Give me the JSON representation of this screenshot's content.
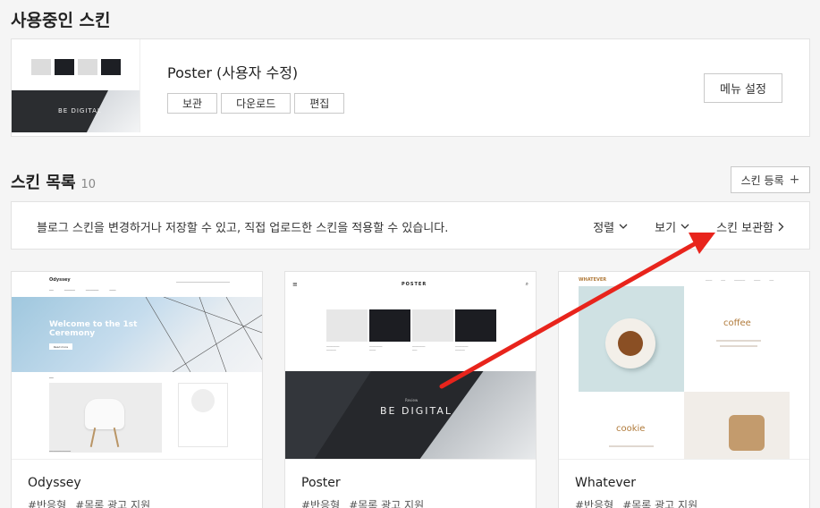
{
  "current": {
    "heading": "사용중인 스킨",
    "title": "Poster (사용자 수정)",
    "buttons": [
      "보관",
      "다운로드",
      "편집"
    ],
    "menu_button": "메뉴 설정",
    "thumb_text": "BE DIGITAL"
  },
  "list": {
    "heading": "스킨 목록",
    "count": "10",
    "register_button": "스킨 등록",
    "info": "블로그 스킨을 변경하거나 저장할 수 있고, 직접 업로드한 스킨을 적용할 수 있습니다.",
    "filters": {
      "sort": "정렬",
      "view": "보기",
      "storage": "스킨 보관함"
    }
  },
  "skins": [
    {
      "name": "Odyssey",
      "tags": [
        "#반응형",
        "#목록 광고 지원"
      ],
      "preview": {
        "logo": "Odyssey",
        "hero_title_1": "Welcome to the 1st",
        "hero_title_2": "Ceremony",
        "hero_button": "Read more"
      }
    },
    {
      "name": "Poster",
      "tags": [
        "#반응형",
        "#목록 광고 지원"
      ],
      "preview": {
        "logo": "POSTER",
        "review": "Review",
        "banner": "BE DIGITAL"
      }
    },
    {
      "name": "Whatever",
      "tags": [
        "#반응형",
        "#목록 광고 지원"
      ],
      "preview": {
        "logo": "WHATEVER",
        "word_1": "coffee",
        "word_2": "cookie"
      }
    }
  ],
  "colors": {
    "accent_arrow": "#e8241c",
    "brand_brown": "#b07a3a"
  }
}
